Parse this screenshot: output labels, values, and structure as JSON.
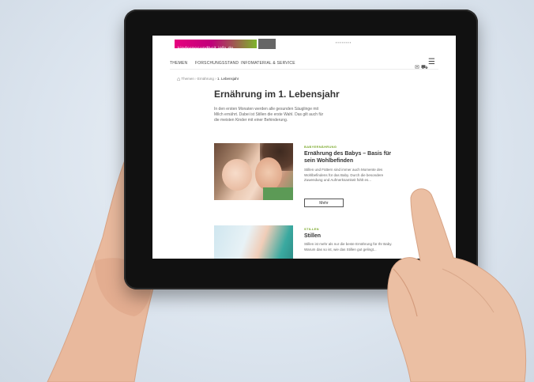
{
  "site": {
    "logo_text": "kindergesundheit-info.de"
  },
  "nav": {
    "items": [
      "THEMEN",
      "FORSCHUNGSSTAND",
      "INFOMATERIAL & SERVICE"
    ],
    "icons": [
      "mail-icon",
      "cart-icon",
      "search-icon",
      "menu-icon"
    ]
  },
  "breadcrumb": {
    "items": [
      "Themen",
      "Ernährung",
      "1. Lebensjahr"
    ]
  },
  "page": {
    "title": "Ernährung im 1. Lebensjahr",
    "intro": "In den ersten Monaten werden alle gesunden Säuglinge mit Milch ernährt. Dabei ist Stillen die erste Wahl. Das gilt auch für die meisten Kinder mit einer Behinderung."
  },
  "article1": {
    "kicker": "BABYERNÄHRUNG",
    "title": "Ernährung des Babys – Basis für sein Wohlbefinden",
    "text": "Stillen und Füttern sind immer auch Momente des Wohlbefindens für das Baby. Durch die besondere Zuwendung und Aufmerksamkeit fühlt es...",
    "button": "Mehr"
  },
  "article2": {
    "kicker": "STILLEN",
    "title": "Stillen",
    "text": "Stillen ist mehr als nur die beste Ernährung für Ihr Baby. Warum das so ist, wie das Stillen gut gelingt..."
  }
}
